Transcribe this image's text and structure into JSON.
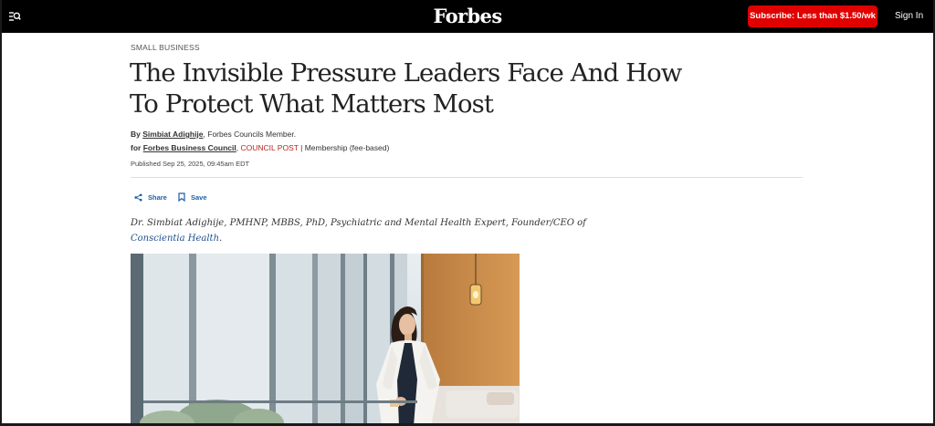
{
  "header": {
    "logo": "Forbes",
    "subscribe_label": "Subscribe: Less than $1.50/wk",
    "signin_label": "Sign In",
    "menu_icon": "menu-search-icon"
  },
  "article": {
    "kicker": "SMALL BUSINESS",
    "headline": "The Invisible Pressure Leaders Face And How To Protect What Matters Most",
    "byline": {
      "by": "By",
      "author": "Simbiat Adighije",
      "author_suffix": ", Forbes Councils Member.",
      "for": "for",
      "council": "Forbes Business Council",
      "comma": ",",
      "council_post": "COUNCIL POST",
      "membership": " | Membership (fee-based)"
    },
    "published": "Published Sep 25, 2025, 09:45am EDT",
    "actions": {
      "share_label": "Share",
      "save_label": "Save"
    },
    "caption": {
      "text_before": "Dr. Simbiat Adighije, PMHNP, MBBS, PhD, Psychiatric and Mental Health Expert, Founder/CEO of ",
      "org": "Conscientia Health",
      "text_after": "."
    }
  },
  "colors": {
    "header_bg": "#000000",
    "subscribe_bg": "#e00000",
    "link_blue": "#1d5fa8",
    "council_red": "#b22222"
  }
}
